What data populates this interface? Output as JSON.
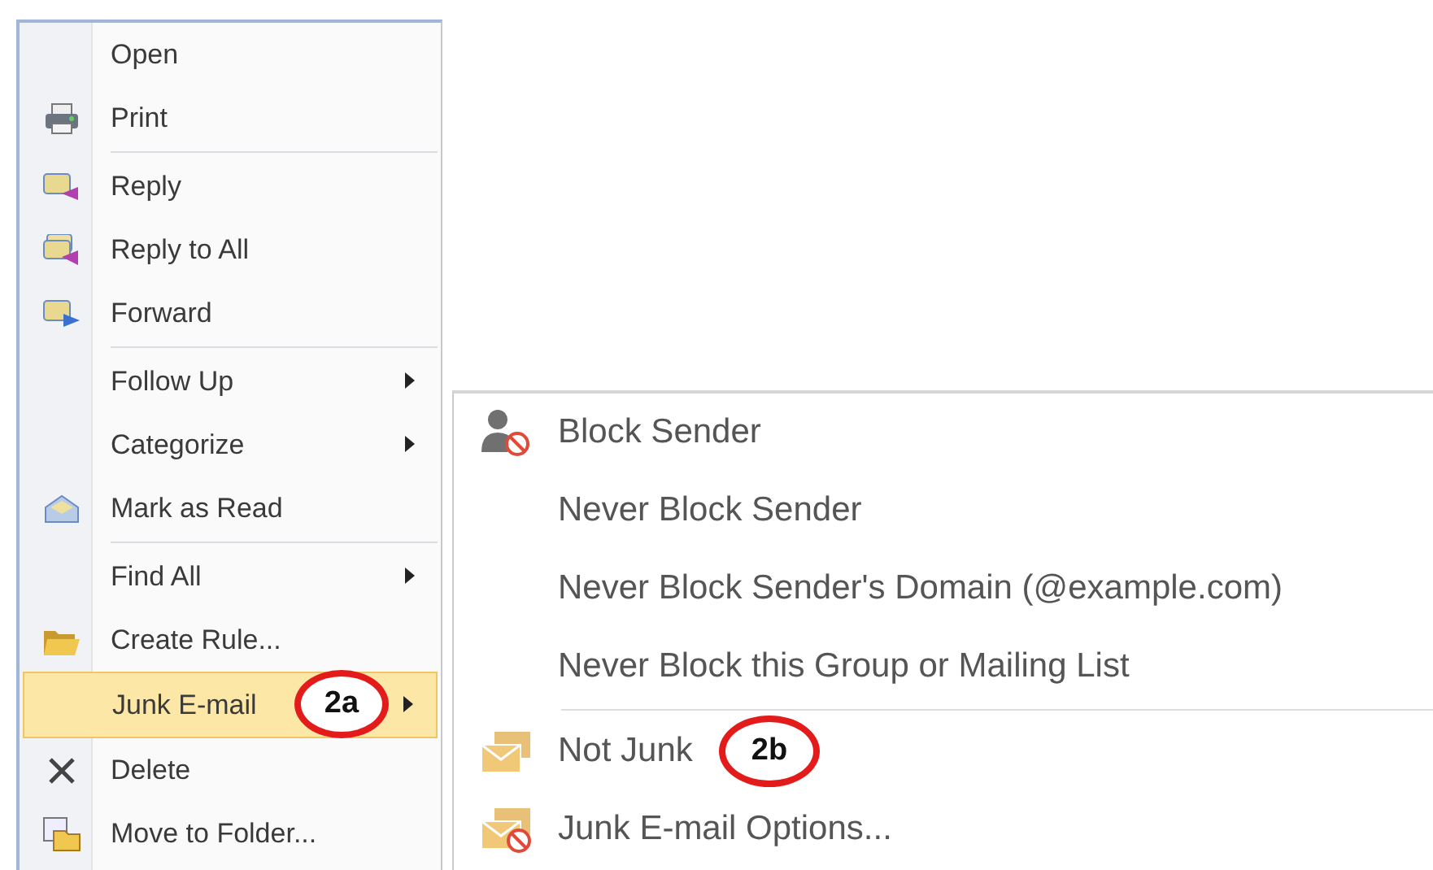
{
  "context_menu": {
    "groups": [
      [
        {
          "label": "Open",
          "submenu": false,
          "selected": false
        },
        {
          "label": "Print",
          "submenu": false,
          "selected": false
        }
      ],
      [
        {
          "label": "Reply",
          "submenu": false,
          "selected": false
        },
        {
          "label": "Reply to All",
          "submenu": false,
          "selected": false
        },
        {
          "label": "Forward",
          "submenu": false,
          "selected": false
        }
      ],
      [
        {
          "label": "Follow Up",
          "submenu": true,
          "selected": false
        },
        {
          "label": "Categorize",
          "submenu": true,
          "selected": false
        },
        {
          "label": "Mark as Read",
          "submenu": false,
          "selected": false
        }
      ],
      [
        {
          "label": "Find All",
          "submenu": true,
          "selected": false
        },
        {
          "label": "Create Rule...",
          "submenu": false,
          "selected": false
        },
        {
          "label": "Junk E-mail",
          "submenu": true,
          "selected": true,
          "callout": "2a"
        },
        {
          "label": "Delete",
          "submenu": false,
          "selected": false
        },
        {
          "label": "Move to Folder...",
          "submenu": false,
          "selected": false
        }
      ]
    ]
  },
  "junk_submenu": {
    "groups": [
      [
        {
          "label": "Block Sender"
        },
        {
          "label": "Never Block Sender"
        },
        {
          "label": "Never Block Sender's Domain (@example.com)"
        },
        {
          "label": "Never Block this Group or Mailing List"
        }
      ],
      [
        {
          "label": "Not Junk",
          "callout": "2b"
        },
        {
          "label": "Junk E-mail Options..."
        }
      ]
    ]
  }
}
